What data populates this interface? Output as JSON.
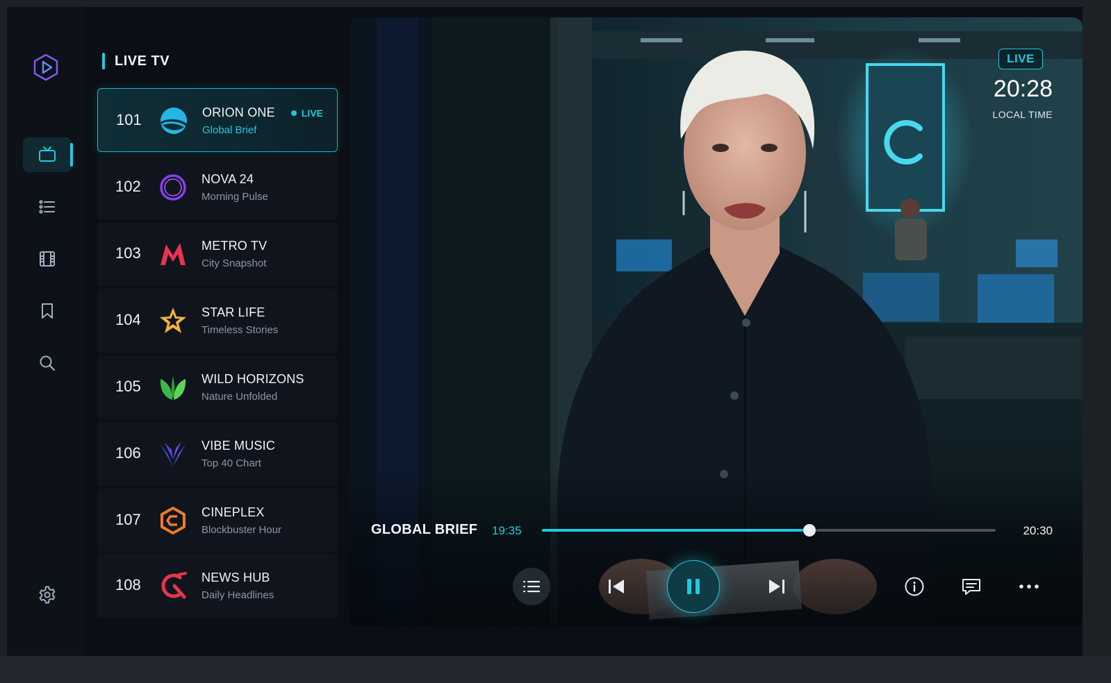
{
  "app": {
    "section_title": "LIVE TV",
    "accent_color": "#22c9df"
  },
  "rail": {
    "items": [
      {
        "icon": "tv-icon",
        "active": true
      },
      {
        "icon": "list-icon",
        "active": false
      },
      {
        "icon": "film-icon",
        "active": false
      },
      {
        "icon": "bookmark-icon",
        "active": false
      },
      {
        "icon": "search-icon",
        "active": false
      }
    ],
    "bottom_icon": "gear-icon"
  },
  "channels": [
    {
      "number": "101",
      "name": "ORION ONE",
      "program": "Global Brief",
      "live_label": "LIVE",
      "logo": "orion-logo",
      "active": true
    },
    {
      "number": "102",
      "name": "NOVA 24",
      "program": "Morning Pulse",
      "logo": "nova-logo"
    },
    {
      "number": "103",
      "name": "METRO TV",
      "program": "City Snapshot",
      "logo": "metro-logo"
    },
    {
      "number": "104",
      "name": "STAR LIFE",
      "program": "Timeless Stories",
      "logo": "star-logo"
    },
    {
      "number": "105",
      "name": "WILD HORIZONS",
      "program": "Nature Unfolded",
      "logo": "leaf-logo"
    },
    {
      "number": "106",
      "name": "VIBE MUSIC",
      "program": "Top 40 Chart",
      "logo": "vibe-logo"
    },
    {
      "number": "107",
      "name": "CINEPLEX",
      "program": "Blockbuster Hour",
      "logo": "cineplex-logo"
    },
    {
      "number": "108",
      "name": "NEWS HUB",
      "program": "Daily Headlines",
      "logo": "newshub-logo"
    }
  ],
  "player": {
    "live_badge": "LIVE",
    "clock": "20:28",
    "clock_label": "LOCAL TIME",
    "now_playing": "GLOBAL BRIEF",
    "start_time": "19:35",
    "end_time": "20:30",
    "progress": 0.59,
    "state": "playing",
    "controls": [
      "list-icon",
      "previous-icon",
      "pause-icon",
      "next-icon",
      "info-icon",
      "chat-icon",
      "more-icon"
    ]
  }
}
